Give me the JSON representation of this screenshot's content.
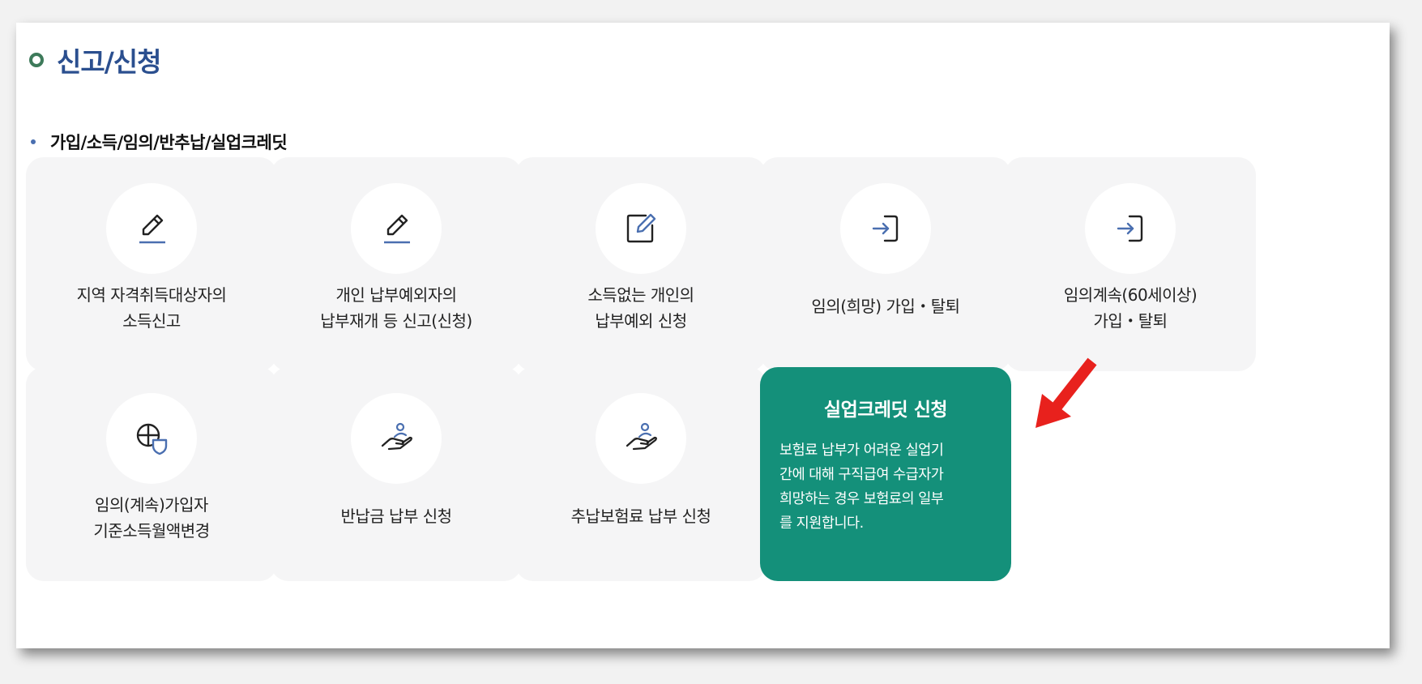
{
  "section": {
    "title": "신고/신청"
  },
  "subsection": {
    "title": "가입/소득/임의/반추납/실업크레딧"
  },
  "cards": [
    {
      "icon": "pencil-icon",
      "lines": [
        "지역 자격취득대상자의",
        "소득신고"
      ]
    },
    {
      "icon": "pencil-icon",
      "lines": [
        "개인 납부예외자의",
        "납부재개 등 신고(신청)"
      ]
    },
    {
      "icon": "edit-square-icon",
      "lines": [
        "소득없는 개인의",
        "납부예외 신청"
      ]
    },
    {
      "icon": "sign-in-icon",
      "lines": [
        "임의(희망) 가입・탈퇴"
      ]
    },
    {
      "icon": "sign-in-icon",
      "lines": [
        "임의계속(60세이상)",
        "가입・탈퇴"
      ]
    },
    {
      "icon": "globe-shield-icon",
      "lines": [
        "임의(계속)가입자",
        "기준소득월액변경"
      ]
    },
    {
      "icon": "hand-person-icon",
      "lines": [
        "반납금 납부 신청"
      ]
    },
    {
      "icon": "hand-person-icon",
      "lines": [
        "추납보험료 납부 신청"
      ]
    }
  ],
  "highlight_card": {
    "title": "실업크레딧 신청",
    "description_lines": [
      "보험료 납부가 어려운 실업기",
      "간에 대해 구직급여 수급자가",
      "희망하는 경우 보험료의 일부",
      "를 지원합니다."
    ],
    "color": "#14907a"
  },
  "annotation": {
    "icon": "red-arrow-icon",
    "color": "#e8211d"
  },
  "colors": {
    "title": "#2b4f8f",
    "card_bg": "#f5f5f6",
    "icon_accent": "#4a6fb0"
  }
}
